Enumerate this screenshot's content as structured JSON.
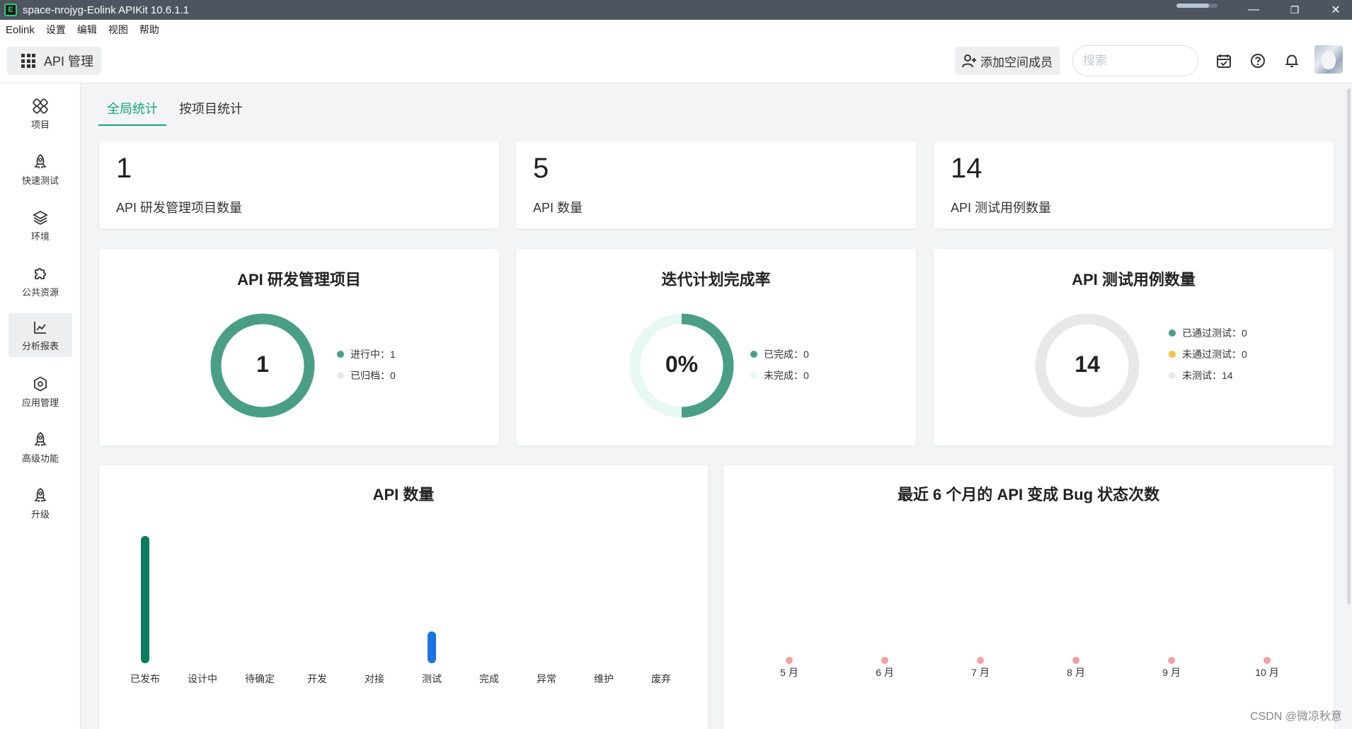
{
  "window": {
    "title": "space-nrojyg-Eolink APIKit 10.6.1.1",
    "icon_letter": "E",
    "minimize": "—",
    "restore": "❐",
    "close": "✕"
  },
  "menu": [
    "Eolink",
    "设置",
    "编辑",
    "视图",
    "帮助"
  ],
  "toolbar": {
    "module_label": "API 管理",
    "add_member_label": "添加空间成员",
    "search_placeholder": "搜索"
  },
  "sidebar": {
    "items": [
      {
        "label": "项目",
        "icon": "project-icon"
      },
      {
        "label": "快速测试",
        "icon": "rocket-icon"
      },
      {
        "label": "环境",
        "icon": "environment-icon"
      },
      {
        "label": "公共资源",
        "icon": "puzzle-icon"
      },
      {
        "label": "分析报表",
        "icon": "chart-icon",
        "active": true
      },
      {
        "label": "应用管理",
        "icon": "gear-icon"
      },
      {
        "label": "高级功能",
        "icon": "rocket-icon"
      },
      {
        "label": "升级",
        "icon": "rocket-icon"
      }
    ]
  },
  "tabs": [
    {
      "label": "全局统计",
      "active": true
    },
    {
      "label": "按项目统计",
      "active": false
    }
  ],
  "stats": [
    {
      "value": "1",
      "label": "API 研发管理项目数量"
    },
    {
      "value": "5",
      "label": "API 数量"
    },
    {
      "value": "14",
      "label": "API 测试用例数量"
    }
  ],
  "donuts": [
    {
      "title": "API 研发管理项目",
      "center": "1",
      "legend": [
        {
          "label": "进行中：1",
          "color": "#4a9e86",
          "value": 1
        },
        {
          "label": "已归档：0",
          "color": "#e8e8e8",
          "value": 0
        }
      ]
    },
    {
      "title": "迭代计划完成率",
      "center": "0%",
      "legend": [
        {
          "label": "已完成：0",
          "color": "#4a9e86",
          "value": 0
        },
        {
          "label": "未完成：0",
          "color": "#e8f8f3",
          "value": 0
        }
      ]
    },
    {
      "title": "API 测试用例数量",
      "center": "14",
      "legend": [
        {
          "label": "已通过测试：0",
          "color": "#4a9e86",
          "value": 0
        },
        {
          "label": "未通过测试：0",
          "color": "#f6c342",
          "value": 0
        },
        {
          "label": "未测试：14",
          "color": "#e8e8e8",
          "value": 14
        }
      ]
    }
  ],
  "chart_data": [
    {
      "type": "bar",
      "title": "API 数量",
      "categories": [
        "已发布",
        "设计中",
        "待确定",
        "开发",
        "对接",
        "测试",
        "完成",
        "异常",
        "维护",
        "废弃"
      ],
      "values": [
        4,
        0,
        0,
        0,
        0,
        1,
        0,
        0,
        0,
        0
      ],
      "colors": {
        "已发布": "#0a7c5c",
        "测试": "#1a73e8"
      }
    },
    {
      "type": "scatter",
      "title": "最近 6 个月的 API 变成 Bug 状态次数",
      "categories": [
        "5 月",
        "6 月",
        "7 月",
        "8 月",
        "9 月",
        "10 月"
      ],
      "values": [
        0,
        0,
        0,
        0,
        0,
        0
      ],
      "color": "#f4a0a0"
    }
  ],
  "watermark": "CSDN @微凉秋意"
}
